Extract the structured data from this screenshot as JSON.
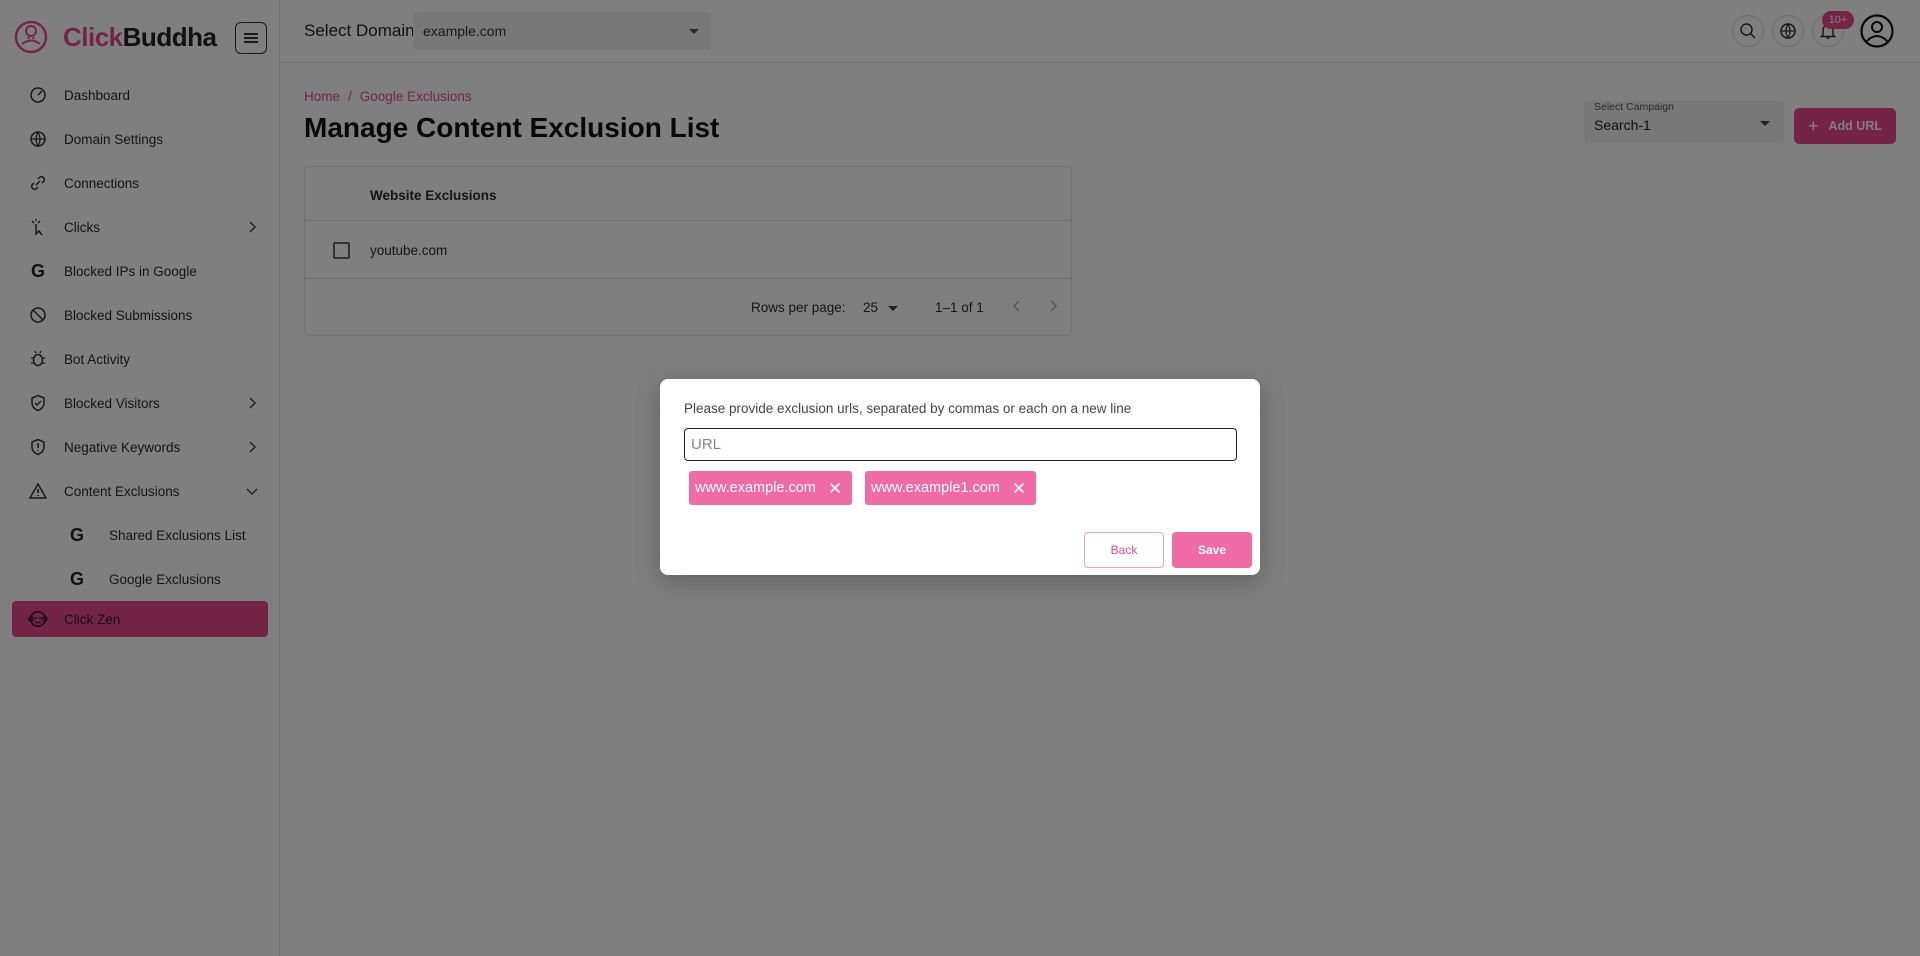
{
  "app": {
    "logo_part1": "Click",
    "logo_part2": "Buddha"
  },
  "sidebar": {
    "items": [
      {
        "label": "Dashboard",
        "icon": "dashboard-icon"
      },
      {
        "label": "Domain Settings",
        "icon": "globe-settings-icon"
      },
      {
        "label": "Connections",
        "icon": "link-icon"
      },
      {
        "label": "Clicks",
        "icon": "click-icon"
      },
      {
        "label": "Blocked IPs in Google",
        "icon": "google-icon"
      },
      {
        "label": "Blocked Submissions",
        "icon": "block-icon"
      },
      {
        "label": "Bot Activity",
        "icon": "bug-icon"
      },
      {
        "label": "Blocked Visitors",
        "icon": "shield-icon"
      },
      {
        "label": "Negative Keywords",
        "icon": "shield-alert-icon"
      },
      {
        "label": "Content Exclusions",
        "icon": "warning-icon"
      },
      {
        "label": "Shared Exclusions List",
        "icon": "google-icon"
      },
      {
        "label": "Google Exclusions",
        "icon": "google-icon"
      },
      {
        "label": "Click Zen",
        "icon": "monkey-icon"
      }
    ]
  },
  "topbar": {
    "domain_label": "Select Domain",
    "domain_value": "example.com",
    "notifications_badge": "10+"
  },
  "breadcrumb": {
    "home": "Home",
    "sep": "/",
    "current": "Google Exclusions"
  },
  "page": {
    "title": "Manage Content Exclusion List"
  },
  "campaign": {
    "label": "Select Campaign",
    "value": "Search-1"
  },
  "add_url": {
    "label": "Add URL"
  },
  "table": {
    "header": "Website Exclusions",
    "rows": [
      "youtube.com"
    ],
    "rows_per_page_label": "Rows per page:",
    "rows_per_page_value": "25",
    "range": "1–1 of 1"
  },
  "modal": {
    "message": "Please provide exclusion urls, separated by commas or each on a new line",
    "input_placeholder": "URL",
    "chips": [
      "www.example.com",
      "www.example1.com"
    ],
    "back_label": "Back",
    "save_label": "Save"
  },
  "colors": {
    "brand": "#e84a8f",
    "chip": "#f06aa5"
  }
}
